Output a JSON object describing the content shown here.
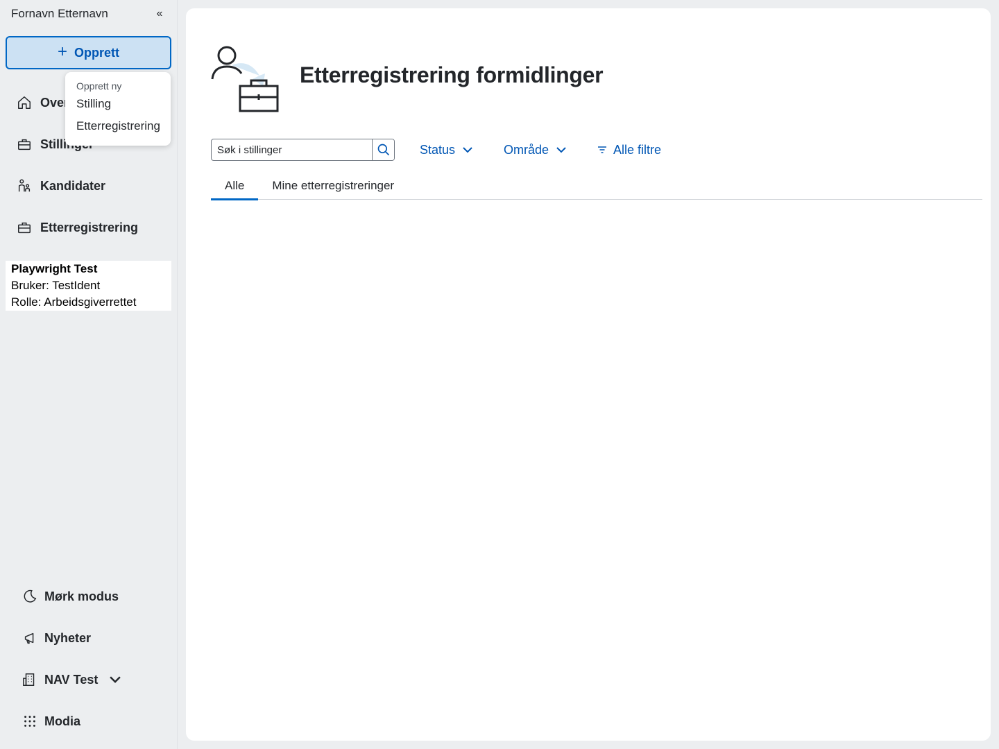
{
  "sidebar": {
    "user_name": "Fornavn Etternavn",
    "collapse_glyph": "«",
    "create_label": "Opprett",
    "nav": [
      {
        "label": "Oversikt",
        "icon": "house-icon"
      },
      {
        "label": "Stillinger",
        "icon": "briefcase-icon"
      },
      {
        "label": "Kandidater",
        "icon": "people-icon"
      },
      {
        "label": "Etterregistrering",
        "icon": "briefcase-icon"
      }
    ],
    "info": {
      "title": "Playwright Test",
      "user": "Bruker: TestIdent",
      "role": "Rolle: Arbeidsgiverrettet"
    },
    "bottom": [
      {
        "label": "Mørk modus",
        "icon": "moon-icon"
      },
      {
        "label": "Nyheter",
        "icon": "megaphone-icon"
      },
      {
        "label": "NAV Test",
        "icon": "building-icon"
      },
      {
        "label": "Modia",
        "icon": "grid-icon"
      }
    ]
  },
  "popover": {
    "heading": "Opprett ny",
    "items": [
      "Stilling",
      "Etterregistrering"
    ]
  },
  "main": {
    "title": "Etterregistrering formidlinger",
    "search_placeholder": "Søk i stillinger",
    "filters": {
      "status": "Status",
      "area": "Område",
      "all": "Alle filtre"
    },
    "tabs": [
      "Alle",
      "Mine etterregistreringer"
    ],
    "active_tab": 0
  },
  "colors": {
    "accent": "#0067c5",
    "link": "#0056b4",
    "sidebar_bg": "#eceef0"
  }
}
